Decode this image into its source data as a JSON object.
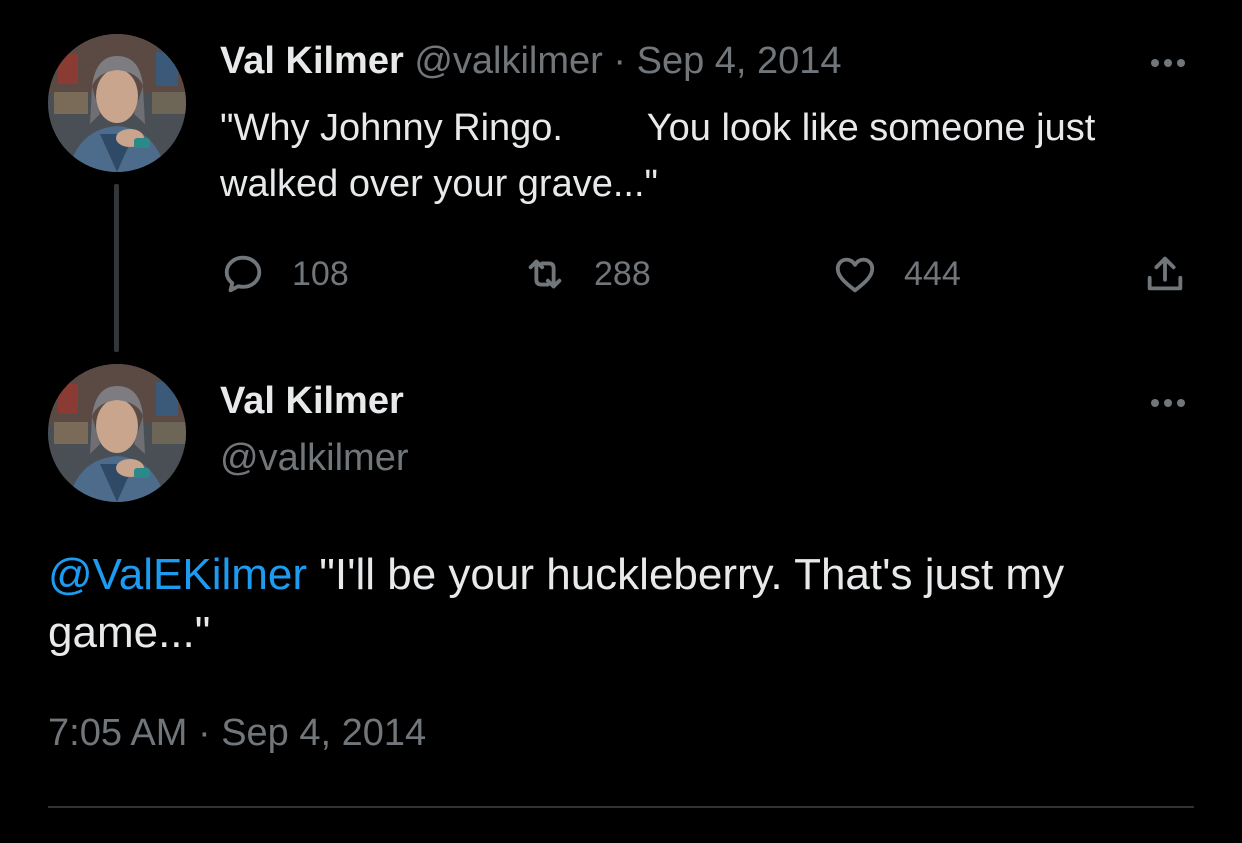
{
  "tweet1": {
    "display_name": "Val Kilmer",
    "handle": "@valkilmer",
    "separator": "·",
    "date": "Sep 4, 2014",
    "text": "\"Why Johnny Ringo.        You look like someone just      walked over your grave...\"",
    "avatar_icon": "profile-photo",
    "more_icon": "more-dots-icon",
    "actions": {
      "reply": {
        "icon": "reply-icon",
        "count": "108"
      },
      "retweet": {
        "icon": "retweet-icon",
        "count": "288"
      },
      "like": {
        "icon": "heart-icon",
        "count": "444"
      },
      "share": {
        "icon": "share-icon"
      }
    }
  },
  "tweet2": {
    "display_name": "Val Kilmer",
    "handle": "@valkilmer",
    "mention": "@ValEKilmer",
    "text": " \"I'll be your huckleberry. That's just my game...\"",
    "time": "7:05 AM",
    "separator": "·",
    "date": "Sep 4, 2014",
    "avatar_icon": "profile-photo",
    "more_icon": "more-dots-icon"
  },
  "colors": {
    "background": "#000000",
    "primary_text": "#e7e9ea",
    "secondary_text": "#71767b",
    "link": "#1d9bf0",
    "divider": "#2f3336",
    "thread_line": "#333639"
  }
}
